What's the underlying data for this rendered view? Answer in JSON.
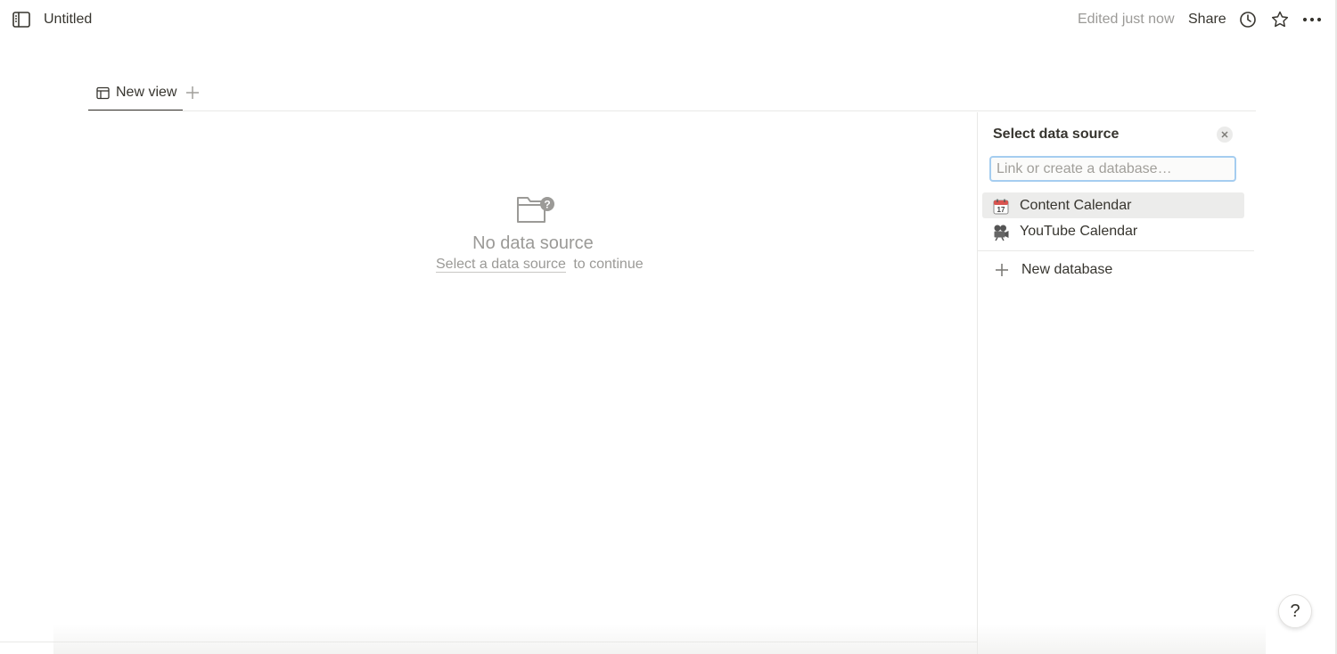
{
  "header": {
    "page_title": "Untitled",
    "edited": "Edited just now",
    "share_label": "Share"
  },
  "tabs": [
    {
      "label": "New view",
      "icon": "table-icon"
    }
  ],
  "empty_state": {
    "title": "No data source",
    "link_text": "Select a data source",
    "suffix": "to continue",
    "icon": "folder-question-icon"
  },
  "side_panel": {
    "title": "Select data source",
    "search_placeholder": "Link or create a database…",
    "databases": [
      {
        "label": "Content Calendar",
        "icon": "calendar-icon",
        "selected": true
      },
      {
        "label": "YouTube Calendar",
        "icon": "movie-camera-icon",
        "selected": false
      }
    ],
    "new_database_label": "New database"
  },
  "help": {
    "label": "?"
  },
  "colors": {
    "text": "#37352f",
    "muted": "#9b9a97",
    "selected_bg": "#ececeb",
    "input_focus": "#a5cdf0"
  }
}
